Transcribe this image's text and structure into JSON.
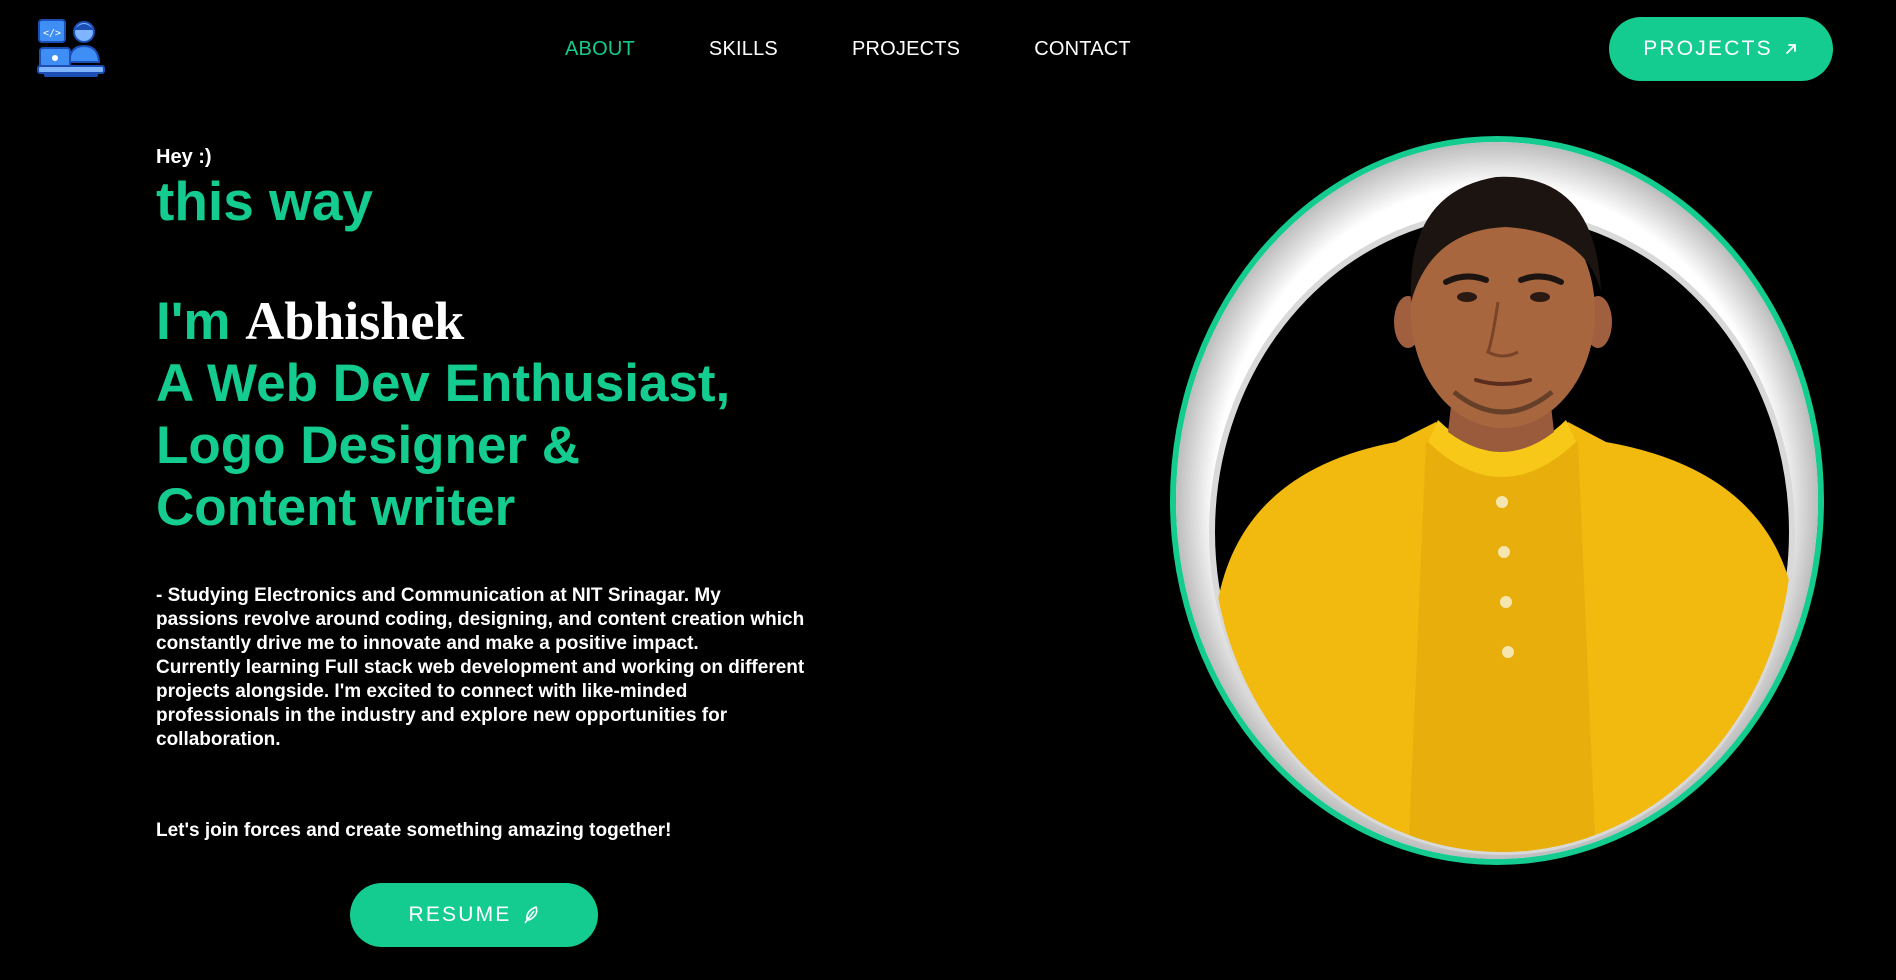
{
  "header": {
    "logo_icon": "developer-at-laptop-icon",
    "nav": [
      {
        "label": "ABOUT",
        "active": true
      },
      {
        "label": "SKILLS",
        "active": false
      },
      {
        "label": "PROJECTS",
        "active": false
      },
      {
        "label": "CONTACT",
        "active": false
      }
    ],
    "cta_label": "PROJECTS",
    "cta_icon": "arrow-up-right-icon"
  },
  "hero": {
    "greeting": "Hey :)",
    "typed_text": "this way",
    "im": "I'm",
    "name": "Abhishek",
    "roles": [
      "A Web Dev Enthusiast,",
      "Logo Designer &",
      "Content writer"
    ],
    "bio_1": "- Studying Electronics and Communication at NIT Srinagar. My passions revolve around coding, designing, and content creation which constantly drive me to innovate and make a positive impact.",
    "bio_2": "Currently learning Full stack web development and working on different projects alongside. I'm excited to connect with like-minded professionals in the industry and explore new opportunities for collaboration.",
    "cta_text": "Let's join forces and create something amazing together!",
    "resume_label": "RESUME",
    "resume_icon": "feather-pen-icon"
  },
  "colors": {
    "accent": "#14cc8f",
    "background": "#000000",
    "text": "#ffffff",
    "kurta": "#f2b90f"
  }
}
